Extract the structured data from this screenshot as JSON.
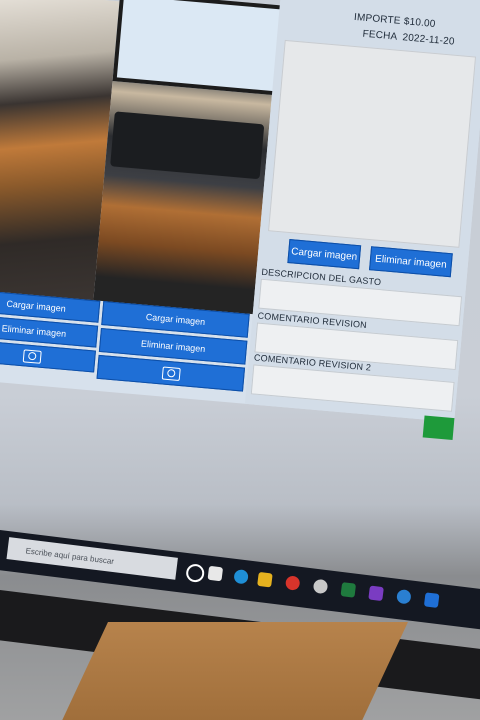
{
  "header": {
    "importe_label": "IMPORTE",
    "importe_value": "$10.00",
    "fecha_label": "FECHA",
    "fecha_value": "2022-11-20"
  },
  "left_buttons": {
    "col1_load": "Cargar imagen",
    "col1_delete": "Eliminar imagen",
    "col2_load": "Cargar imagen",
    "col2_delete": "Eliminar imagen"
  },
  "right_panel": {
    "load": "Cargar imagen",
    "delete": "Eliminar imagen",
    "descripcion_label": "DESCRIPCION DEL GASTO",
    "comentario_label": "COMENTARIO REVISION",
    "comentario2_label": "COMENTARIO REVISION 2"
  },
  "taskbar": {
    "search_placeholder": "Escribe aquí para buscar"
  }
}
